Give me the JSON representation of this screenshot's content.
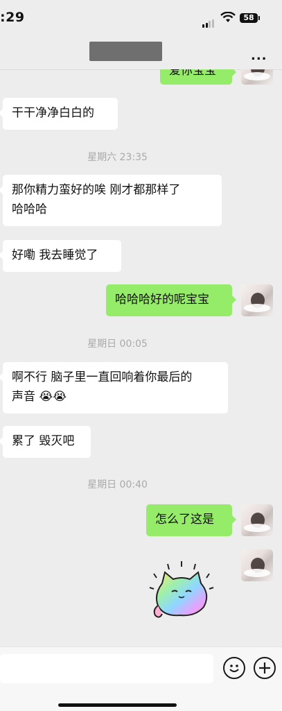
{
  "status_bar": {
    "time": ":29",
    "battery": "58"
  },
  "nav": {
    "more_label": "..."
  },
  "messages": [
    {
      "side": "right",
      "text": "爱你宝宝"
    },
    {
      "side": "left",
      "text": "干干净净白白的"
    },
    {
      "timestamp": "星期六 23:35"
    },
    {
      "side": "left",
      "line1": "那你精力蛮好的唉  刚才都那样了",
      "line2": "哈哈哈"
    },
    {
      "side": "left",
      "text": "好嘞  我去睡觉了"
    },
    {
      "side": "right",
      "text": "哈哈哈好的呢宝宝"
    },
    {
      "timestamp": "星期日 00:05"
    },
    {
      "side": "left",
      "line1": "啊不行  脑子里一直回响着你最后的",
      "line2": "声音",
      "emoji": "😭😭"
    },
    {
      "side": "left",
      "text": "累了 毁灭吧"
    },
    {
      "timestamp": "星期日 00:40"
    },
    {
      "side": "right",
      "text": "怎么了这是"
    },
    {
      "side": "right",
      "sticker": "rainbow-cat-sticker"
    }
  ],
  "icons": {
    "emoji_button": "smiley-icon",
    "plus_button": "plus-icon"
  }
}
